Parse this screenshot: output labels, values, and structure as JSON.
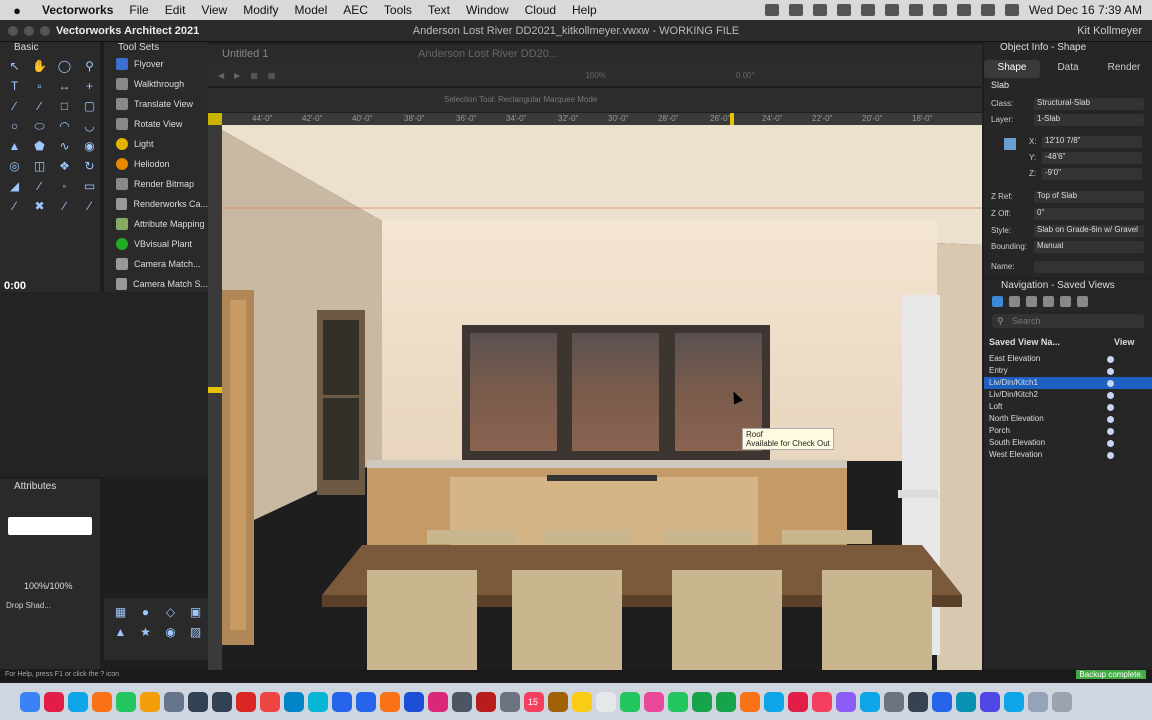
{
  "menubar": {
    "app": "Vectorworks",
    "items": [
      "File",
      "Edit",
      "View",
      "Modify",
      "Model",
      "AEC",
      "Tools",
      "Text",
      "Window",
      "Cloud",
      "Help"
    ],
    "clock": "Wed Dec 16  7:39 AM"
  },
  "titlebar": {
    "app_name": "Vectorworks Architect 2021",
    "document": "Anderson Lost River DD2021_kitkollmeyer.vwxw - WORKING FILE",
    "user": "Kit Kollmeyer"
  },
  "tools_left": {
    "title": "Basic",
    "timer": "0:00"
  },
  "toolsets": {
    "title": "Tool Sets",
    "items": [
      "Flyover",
      "Walkthrough",
      "Translate View",
      "Rotate View",
      "Light",
      "Heliodon",
      "Render Bitmap",
      "Renderworks Ca...",
      "Attribute Mapping",
      "VBvisual Plant",
      "Camera Match...",
      "Camera Match S..."
    ]
  },
  "attributes": {
    "title": "Attributes",
    "opacity": "100%/100%",
    "drop_shadow": "Drop Shad..."
  },
  "tabs": {
    "tab1": "Untitled 1",
    "tab2": "Anderson Lost River DD20..."
  },
  "viewbar": {
    "zoom": "100%",
    "angle": "0.00°"
  },
  "modebar": {
    "hint": "Selection Tool: Rectangular Marquee Mode"
  },
  "ruler": {
    "ticks": [
      "44'-0\"",
      "42'-0\"",
      "40'-0\"",
      "38'-0\"",
      "36'-0\"",
      "34'-0\"",
      "32'-0\"",
      "30'-0\"",
      "28'-0\"",
      "26'-0\"",
      "24'-0\"",
      "22'-0\"",
      "20'-0\"",
      "18'-0\""
    ]
  },
  "tooltip": {
    "line1": "Roof",
    "line2": "Available for Check Out"
  },
  "obj_info": {
    "title": "Object Info - Shape",
    "tabs": [
      "Shape",
      "Data",
      "Render"
    ],
    "type": "Slab",
    "class": "Structural-Slab",
    "layer": "1-Slab",
    "x": "12'10 7/8\"",
    "y": "-48'6\"",
    "z": "-9'0\"",
    "z_ref": "Top of Slab",
    "z_off": "0\"",
    "style": "Slab on Grade-6in w/ Gravel",
    "bounding": "Manual",
    "labels": {
      "class": "Class:",
      "layer": "Layer:",
      "x": "X:",
      "y": "Y:",
      "z": "Z:",
      "z_ref": "Z Ref:",
      "z_off": "Z Off:",
      "style": "Style:",
      "bounding": "Bounding:",
      "name": "Name:"
    }
  },
  "nav": {
    "title": "Navigation - Saved Views",
    "search_placeholder": "Search",
    "col_name": "Saved View Na...",
    "col_view": "View",
    "items": [
      "East Elevation",
      "Entry",
      "Liv/Din/Kitch1",
      "Liv/Din/Kitch2",
      "Loft",
      "North Elevation",
      "Porch",
      "South Elevation",
      "West Elevation"
    ],
    "selected_index": 2
  },
  "status": {
    "help": "For Help, press F1 or click the ? icon",
    "backup": "Backup complete."
  },
  "dock": {
    "badge": "15"
  }
}
